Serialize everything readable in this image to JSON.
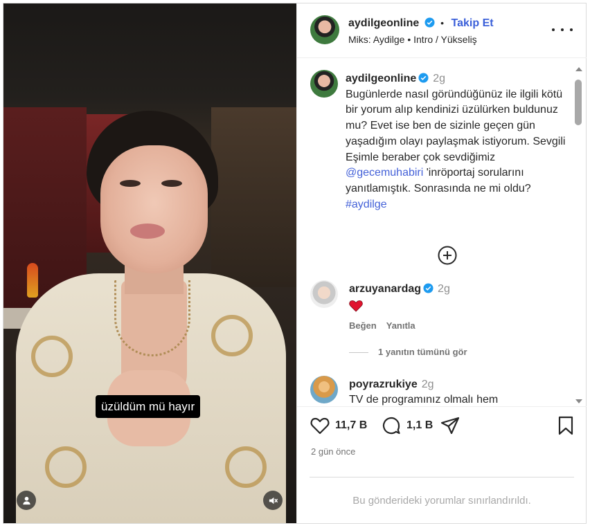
{
  "video": {
    "caption": "üzüldüm mü hayır",
    "icons": {
      "profile": "person-icon",
      "sound": "sound-muted-icon"
    }
  },
  "header": {
    "username": "aydilgeonline",
    "follow_label": "Takip Et",
    "dot": "•",
    "audio": "Miks: Aydilge • Intro / Yükseliş"
  },
  "post": {
    "username": "aydilgeonline",
    "time": "2g",
    "text_parts": [
      "Bugünlerde nasıl göründüğünüz ile ilgili kötü bir yorum alıp kendinizi üzülürken buldunuz mu? Evet ise ben de sizinle geçen gün yaşadığım olayı paylaşmak istiyorum. Sevgili Eşimle beraber çok sevdiğimiz ",
      "@gecemuhabiri",
      " 'inröportaj sorularını yanıtlamıştık. Sonrasında ne mi oldu? ",
      "#aydilge"
    ]
  },
  "comments": [
    {
      "username": "arzuyanardag",
      "time": "2g",
      "text": "",
      "emoji": "red-heart",
      "like_label": "Beğen",
      "reply_label": "Yanıtla",
      "verified": true
    },
    {
      "username": "poyrazrukiye",
      "time": "2g",
      "text": "TV de programınız olmalı hem",
      "verified": false
    }
  ],
  "view_replies": "1 yanıtın tümünü gör",
  "actions": {
    "likes": "11,7 B",
    "comments": "1,1 B"
  },
  "posted_ago": "2 gün önce",
  "comments_limited": "Bu gönderideki yorumlar sınırlandırıldı.",
  "colors": {
    "accent": "#3a5fd9",
    "link": "#4461d8",
    "verified": "#1d9bf0",
    "heart": "#e0142f"
  }
}
